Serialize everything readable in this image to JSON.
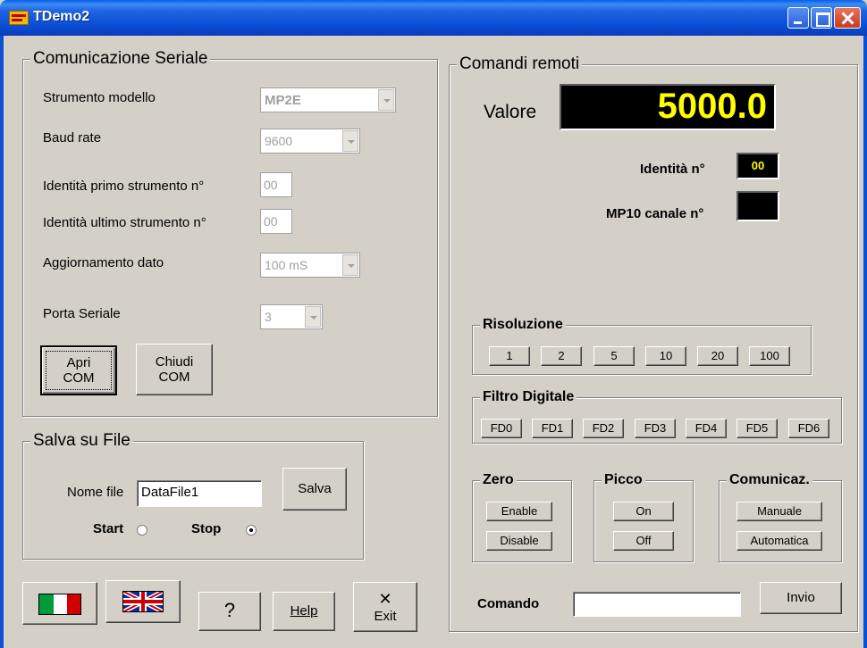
{
  "window": {
    "title": "TDemo2"
  },
  "serial": {
    "title": "Comunicazione Seriale",
    "model_label": "Strumento modello",
    "model_value": "MP2E",
    "baud_label": "Baud rate",
    "baud_value": "9600",
    "first_id_label": "Identità primo strumento n°",
    "first_id_value": "00",
    "last_id_label": "Identità ultimo strumento n°",
    "last_id_value": "00",
    "update_label": "Aggiornamento dato",
    "update_value": "100 mS",
    "port_label": "Porta Seriale",
    "port_value": "3",
    "open_line1": "Apri",
    "open_line2": "COM",
    "close_line1": "Chiudi",
    "close_line2": "COM"
  },
  "save": {
    "title": "Salva su File",
    "filename_label": "Nome file",
    "filename_value": "DataFile1",
    "save_label": "Salva",
    "start_label": "Start",
    "stop_label": "Stop",
    "selected": "Stop"
  },
  "bottom": {
    "help_question": "?",
    "help_label": "Help",
    "exit_label": "Exit",
    "exit_icon_glyph": "✕"
  },
  "remote": {
    "title": "Comandi remoti",
    "value_label": "Valore",
    "value": "5000.0",
    "identity_label": "Identità n°",
    "identity_value": "00",
    "mp10_label": "MP10 canale n°",
    "mp10_value": ""
  },
  "resolution": {
    "title": "Risoluzione",
    "buttons": [
      "1",
      "2",
      "5",
      "10",
      "20",
      "100"
    ]
  },
  "filter": {
    "title": "Filtro Digitale",
    "buttons": [
      "FD0",
      "FD1",
      "FD2",
      "FD3",
      "FD4",
      "FD5",
      "FD6"
    ]
  },
  "zero": {
    "title": "Zero",
    "enable": "Enable",
    "disable": "Disable"
  },
  "peak": {
    "title": "Picco",
    "on": "On",
    "off": "Off"
  },
  "comm": {
    "title": "Comunicaz.",
    "manual": "Manuale",
    "auto": "Automatica"
  },
  "command": {
    "label": "Comando",
    "value": "",
    "send": "Invio"
  }
}
